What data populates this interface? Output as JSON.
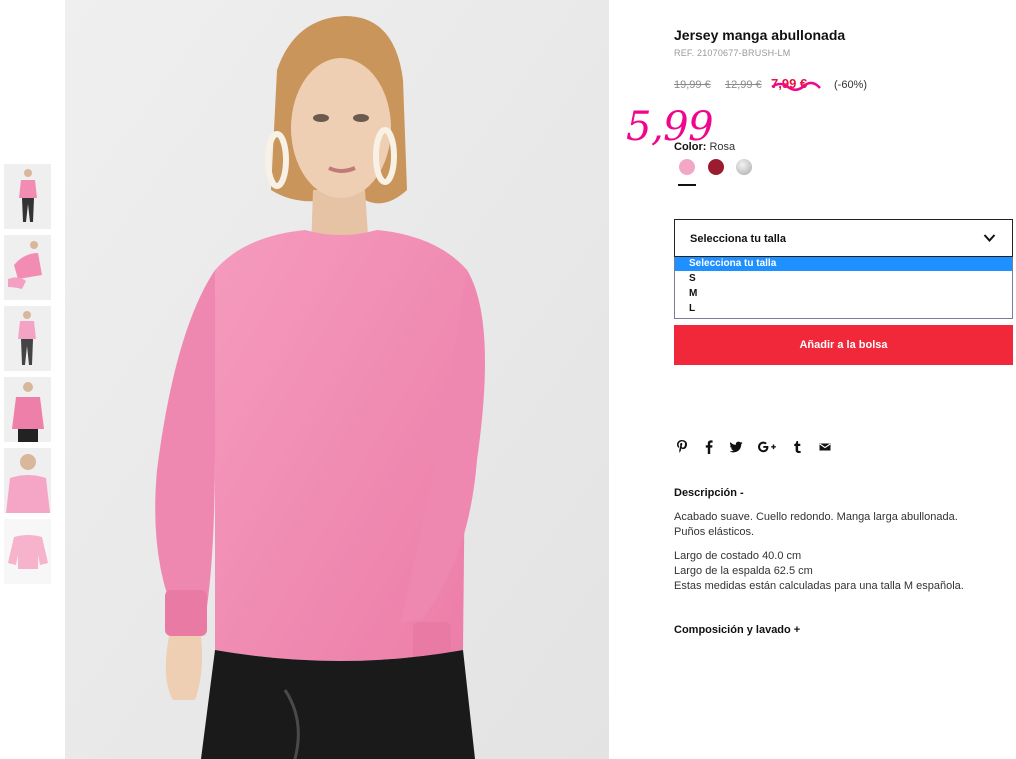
{
  "product": {
    "title": "Jersey manga abullonada",
    "ref": "REF. 21070677-BRUSH-LM",
    "prices": {
      "original": "19,99 €",
      "previous": "12,99 €",
      "sale": "7,99 €",
      "discount": "(-60%)"
    },
    "handwritten_price": "5,99",
    "color": {
      "label": "Color:",
      "value": "Rosa",
      "swatches": [
        {
          "name": "pink",
          "hex": "#f3a7c6",
          "selected": true
        },
        {
          "name": "burgundy",
          "hex": "#9b1c2e",
          "selected": false
        },
        {
          "name": "grey-marl",
          "hex": "#c7c7c7",
          "selected": false
        }
      ]
    },
    "size_select": {
      "label": "Selecciona tu talla",
      "options": [
        "Selecciona tu talla",
        "S",
        "M",
        "L"
      ],
      "highlighted": "Selecciona tu talla"
    },
    "add_to_bag": "Añadir a la bolsa",
    "share_icons": [
      "pinterest-icon",
      "facebook-icon",
      "twitter-icon",
      "google-plus-icon",
      "tumblr-icon",
      "email-icon"
    ],
    "description": {
      "heading": "Descripción -",
      "lines": [
        "Acabado suave. Cuello redondo. Manga larga abullonada.",
        "Puños elásticos.",
        "Largo de costado 40.0 cm",
        "Largo de la espalda 62.5 cm",
        "Estas medidas están calculadas para una talla M española."
      ]
    },
    "composition": {
      "heading": "Composición y lavado +"
    }
  },
  "colors": {
    "accent": "#f0283a",
    "sale_price": "#e8133b",
    "handwritten": "#f0068c",
    "option_highlight": "#1e90ff",
    "sweater_pink": "#f28cb3"
  },
  "thumbnails": [
    "full-body-front",
    "side-view",
    "full-body-front-2",
    "sleeve-detail",
    "close-up-front",
    "flat-lay"
  ]
}
